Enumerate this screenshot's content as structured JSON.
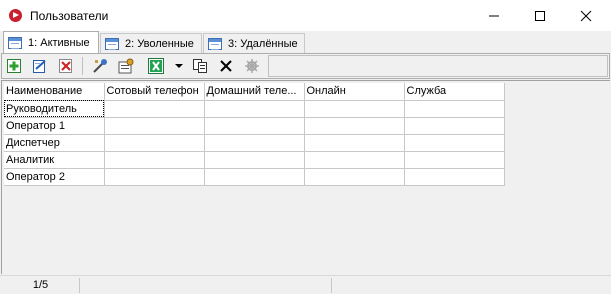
{
  "window": {
    "title": "Пользователи",
    "icon": "app-record-icon",
    "accent": "#c8202f"
  },
  "tabs": [
    {
      "label": "1: Активные",
      "active": true,
      "icon": "grid-icon"
    },
    {
      "label": "2: Уволенные",
      "active": false,
      "icon": "grid-icon"
    },
    {
      "label": "3: Удалённые",
      "active": false,
      "icon": "grid-icon"
    }
  ],
  "toolbar": {
    "buttons": [
      {
        "name": "add-button",
        "icon": "add-icon"
      },
      {
        "name": "edit-button",
        "icon": "edit-icon"
      },
      {
        "name": "delete-button",
        "icon": "delete-icon"
      },
      {
        "name": "tools-button",
        "icon": "tools-icon"
      },
      {
        "name": "properties-button",
        "icon": "properties-icon"
      },
      {
        "name": "export-excel-button",
        "icon": "excel-icon"
      },
      {
        "name": "dropdown-button",
        "icon": "dropdown-arrow-icon"
      },
      {
        "name": "copy-button",
        "icon": "copy-icon"
      },
      {
        "name": "close-x-button",
        "icon": "x-icon"
      },
      {
        "name": "disabled-button",
        "icon": "gear-disabled-icon"
      }
    ]
  },
  "table": {
    "columns": [
      "Наименование",
      "Сотовый телефон",
      "Домашний теле...",
      "Онлайн",
      "Служба"
    ],
    "rows": [
      [
        "Руководитель",
        "",
        "",
        "",
        ""
      ],
      [
        "Оператор 1",
        "",
        "",
        "",
        ""
      ],
      [
        "Диспетчер",
        "",
        "",
        "",
        ""
      ],
      [
        "Аналитик",
        "",
        "",
        "",
        ""
      ],
      [
        "Оператор 2",
        "",
        "",
        "",
        ""
      ]
    ]
  },
  "status": {
    "count": "1/5"
  }
}
